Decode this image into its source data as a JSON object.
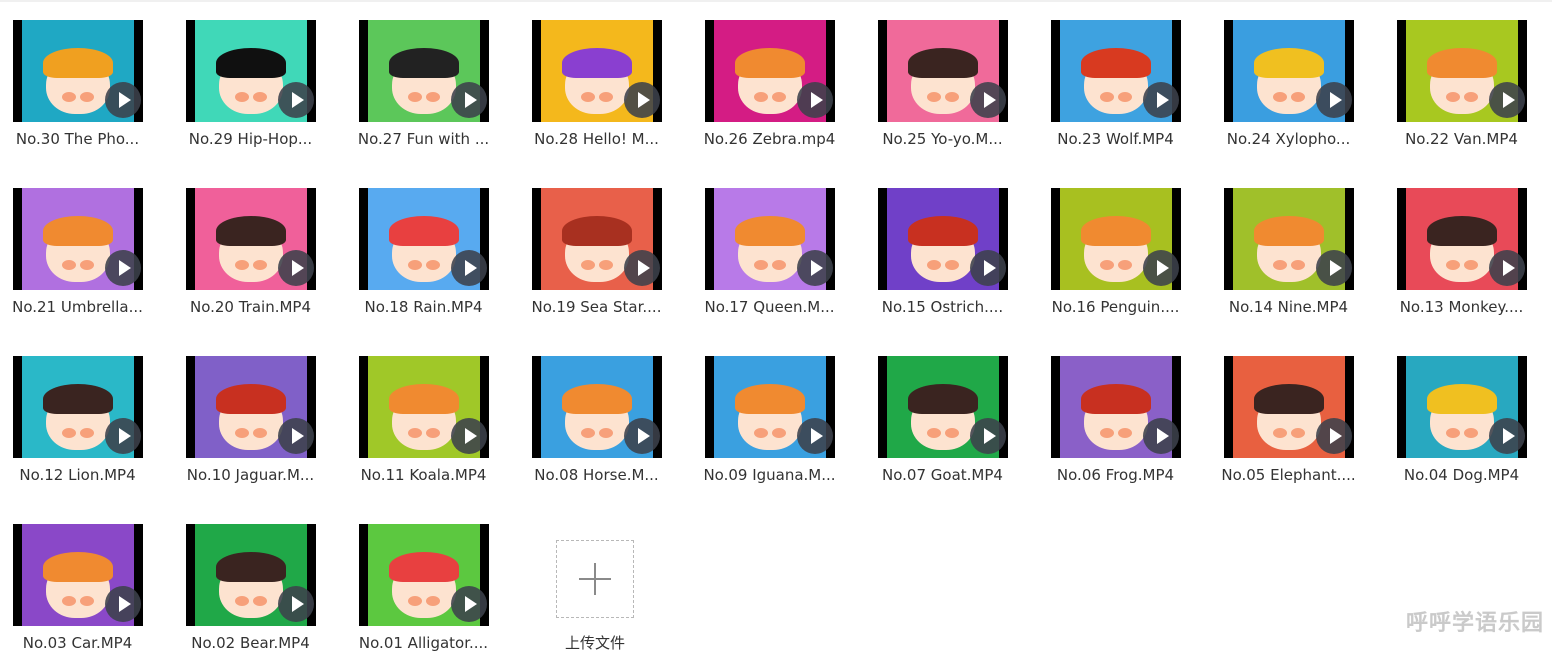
{
  "files": [
    {
      "name": "No.30 The Pho...",
      "bg": "#1fa8c4",
      "hair": "#f0a020"
    },
    {
      "name": "No.29 Hip-Hop...",
      "bg": "#40d8b8",
      "hair": "#101010"
    },
    {
      "name": "No.27 Fun with ...",
      "bg": "#5cc75a",
      "hair": "#222222"
    },
    {
      "name": "No.28 Hello! M...",
      "bg": "#f4b81c",
      "hair": "#8a3fd0"
    },
    {
      "name": "No.26 Zebra.mp4",
      "bg": "#d41c84",
      "hair": "#f08a30"
    },
    {
      "name": "No.25 Yo-yo.M...",
      "bg": "#f06a9a",
      "hair": "#3a2420"
    },
    {
      "name": "No.23 Wolf.MP4",
      "bg": "#3ea2e0",
      "hair": "#d83a20"
    },
    {
      "name": "No.24 Xylopho...",
      "bg": "#3a9ee0",
      "hair": "#f0c020"
    },
    {
      "name": "No.22 Van.MP4",
      "bg": "#a8c820",
      "hair": "#f08a30"
    },
    {
      "name": "No.21 Umbrella...",
      "bg": "#b070e0",
      "hair": "#f08a30"
    },
    {
      "name": "No.20 Train.MP4",
      "bg": "#f0609a",
      "hair": "#3a2420"
    },
    {
      "name": "No.18 Rain.MP4",
      "bg": "#58aaf0",
      "hair": "#e84040"
    },
    {
      "name": "No.19 Sea Star....",
      "bg": "#e8604a",
      "hair": "#a83020"
    },
    {
      "name": "No.17 Queen.M...",
      "bg": "#b87ae8",
      "hair": "#f08a30"
    },
    {
      "name": "No.15 Ostrich....",
      "bg": "#7040c8",
      "hair": "#c83020"
    },
    {
      "name": "No.16 Penguin....",
      "bg": "#a8c020",
      "hair": "#f08a30"
    },
    {
      "name": "No.14 Nine.MP4",
      "bg": "#a0c02a",
      "hair": "#f08a30"
    },
    {
      "name": "No.13 Monkey....",
      "bg": "#e84a58",
      "hair": "#3a2420"
    },
    {
      "name": "No.12 Lion.MP4",
      "bg": "#2ab8c8",
      "hair": "#3a2420"
    },
    {
      "name": "No.10 Jaguar.M...",
      "bg": "#8060c8",
      "hair": "#c83020"
    },
    {
      "name": "No.11 Koala.MP4",
      "bg": "#a0c828",
      "hair": "#f08a30"
    },
    {
      "name": "No.08 Horse.M...",
      "bg": "#3aa0e0",
      "hair": "#f08a30"
    },
    {
      "name": "No.09 Iguana.M...",
      "bg": "#3aa0e0",
      "hair": "#f08a30"
    },
    {
      "name": "No.07 Goat.MP4",
      "bg": "#20a848",
      "hair": "#3a2420"
    },
    {
      "name": "No.06 Frog.MP4",
      "bg": "#8a60c8",
      "hair": "#c83020"
    },
    {
      "name": "No.05 Elephant....",
      "bg": "#e86040",
      "hair": "#3a2420"
    },
    {
      "name": "No.04 Dog.MP4",
      "bg": "#28a8c0",
      "hair": "#f0c020"
    },
    {
      "name": "No.03 Car.MP4",
      "bg": "#8a48c8",
      "hair": "#f08a30"
    },
    {
      "name": "No.02 Bear.MP4",
      "bg": "#20a848",
      "hair": "#3a2420"
    },
    {
      "name": "No.01 Alligator....",
      "bg": "#5cc840",
      "hair": "#e84040"
    }
  ],
  "upload": {
    "label": "上传文件"
  },
  "watermark": "呼呼学语乐园"
}
